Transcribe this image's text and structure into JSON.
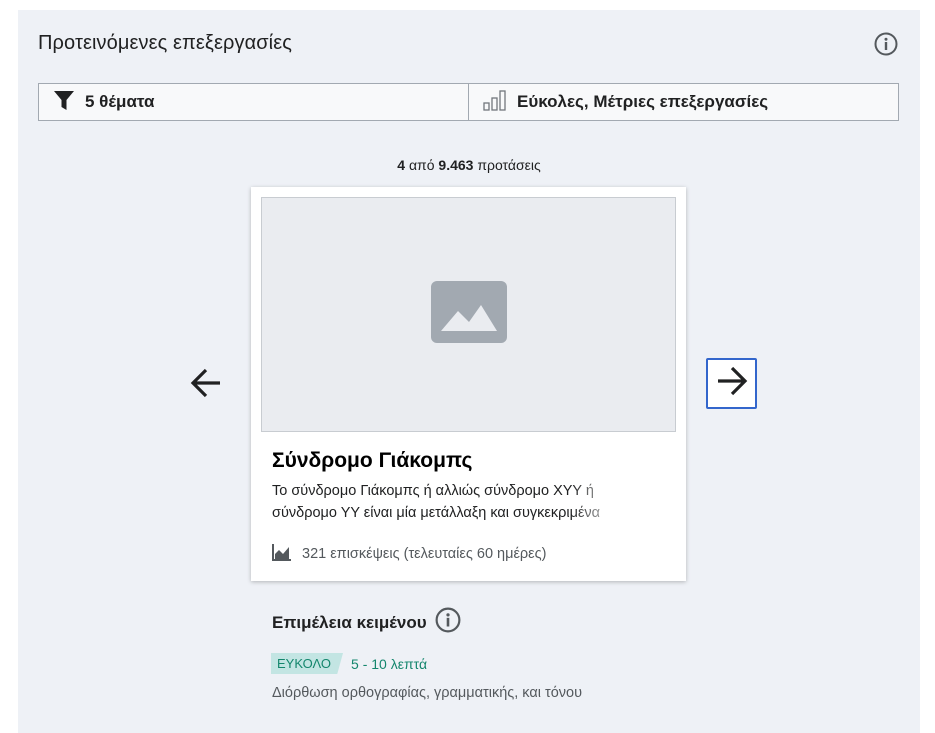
{
  "header": {
    "title": "Προτεινόμενες επεξεργασίες",
    "info_icon": "info-icon"
  },
  "filters": {
    "topics_label": "5 θέματα",
    "topics_icon": "funnel-icon",
    "difficulty_label": "Εύκολες, Μέτριες επεξεργασίες",
    "difficulty_icon": "bar-chart-icon"
  },
  "pager": {
    "current": "4",
    "of_text": " από ",
    "total": "9.463",
    "suffix": " προτάσεις"
  },
  "card": {
    "image_icon": "image-placeholder-icon",
    "title": "Σύνδρομο Γιάκομπς",
    "extract": "Το σύνδρομο Γιάκομπς ή αλλιώς σύνδρομο ΧΥΥ ή σύνδρομο ΥΥ είναι μία μετάλλαξη και συγκεκριμένα",
    "views_icon": "area-chart-icon",
    "views": "321 επισκέψεις (τελευταίες 60 ημέρες)"
  },
  "task": {
    "type": "Επιμέλεια κειμένου",
    "difficulty": "ΕΥΚΟΛΟ",
    "time": "5 - 10 λεπτά",
    "description": "Διόρθωση ορθογραφίας, γραμματικής, και τόνου"
  },
  "colors": {
    "panel_bg": "#eef1f6",
    "accent": "#3366cc",
    "easy_badge_bg": "#c3e5e3",
    "easy_text": "#14866d"
  }
}
